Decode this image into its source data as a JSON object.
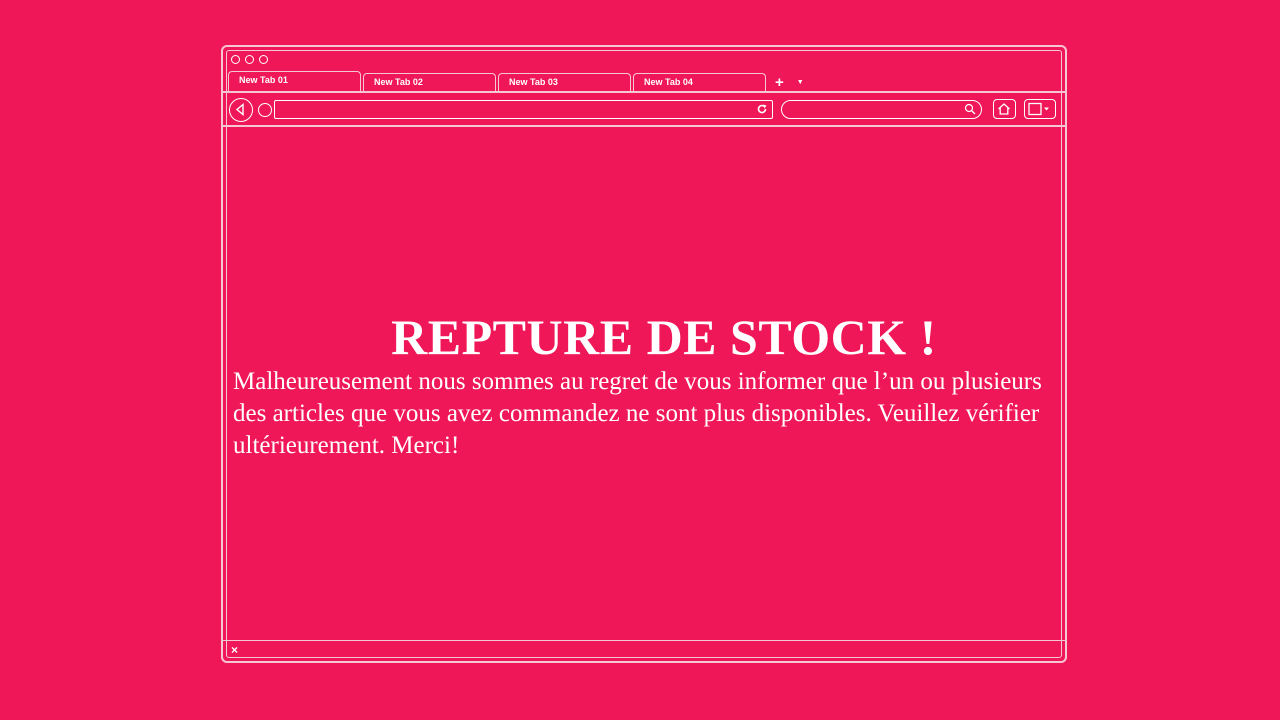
{
  "browser": {
    "tabs": [
      {
        "label": "New Tab 01"
      },
      {
        "label": "New Tab 02"
      },
      {
        "label": "New Tab 03"
      },
      {
        "label": "New Tab 04"
      }
    ],
    "new_tab_symbol": "+",
    "tab_menu_symbol": "▼",
    "address_value": "",
    "search_value": "",
    "statusbar_close_symbol": "×"
  },
  "page": {
    "headline": "REPTURE DE STOCK !",
    "message": "Malheureusement nous sommes au regret de vous informer que l’un ou plusieurs des articles que vous avez commandez ne sont plus disponibles. Veuillez vérifier ultérieurement. Merci!"
  },
  "colors": {
    "background": "#f01758",
    "outline": "#f7c6d4",
    "text": "#ffffff"
  },
  "icons": {
    "back": "back-arrow-icon",
    "stop": "circle-icon",
    "reload": "reload-icon",
    "search": "search-icon",
    "home": "home-icon",
    "menu": "window-menu-icon",
    "close": "close-icon"
  }
}
